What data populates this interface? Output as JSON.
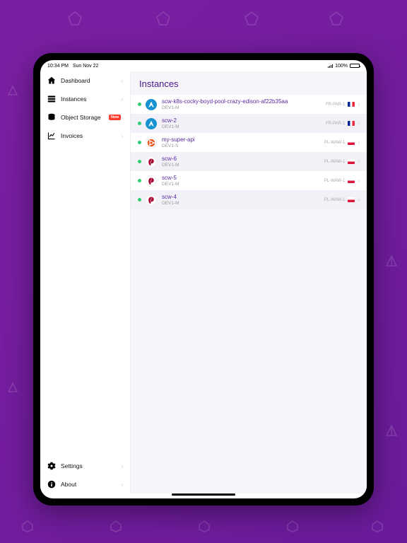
{
  "status": {
    "time": "10:34 PM",
    "date": "Sun Nov 22",
    "battery": "100%"
  },
  "sidebar": {
    "items": [
      {
        "label": "Dashboard",
        "icon": "home-icon"
      },
      {
        "label": "Instances",
        "icon": "servers-icon"
      },
      {
        "label": "Object Storage",
        "icon": "database-icon",
        "badge": "New"
      },
      {
        "label": "Invoices",
        "icon": "chart-icon"
      }
    ],
    "bottom": [
      {
        "label": "Settings",
        "icon": "gear-icon"
      },
      {
        "label": "About",
        "icon": "info-icon"
      }
    ]
  },
  "main": {
    "title": "Instances",
    "rows": [
      {
        "name": "scw-k8s-cocky-boyd-pool-crazy-edison-af22b35aa",
        "type": "DEV1-M",
        "region": "FR-PAR-1",
        "flag": "fr",
        "os": "arch"
      },
      {
        "name": "scw-2",
        "type": "DEV1-M",
        "region": "FR-PAR-1",
        "flag": "fr",
        "os": "arch"
      },
      {
        "name": "my-super-api",
        "type": "DEV1-S",
        "region": "PL-WAW-1",
        "flag": "pl",
        "os": "ubuntu"
      },
      {
        "name": "scw-6",
        "type": "DEV1-M",
        "region": "PL-WAW-1",
        "flag": "pl",
        "os": "debian"
      },
      {
        "name": "scw-5",
        "type": "DEV1-M",
        "region": "PL-WAW-1",
        "flag": "pl",
        "os": "debian"
      },
      {
        "name": "scw-4",
        "type": "DEV1-M",
        "region": "PL-WAW-1",
        "flag": "pl",
        "os": "debian"
      }
    ]
  }
}
